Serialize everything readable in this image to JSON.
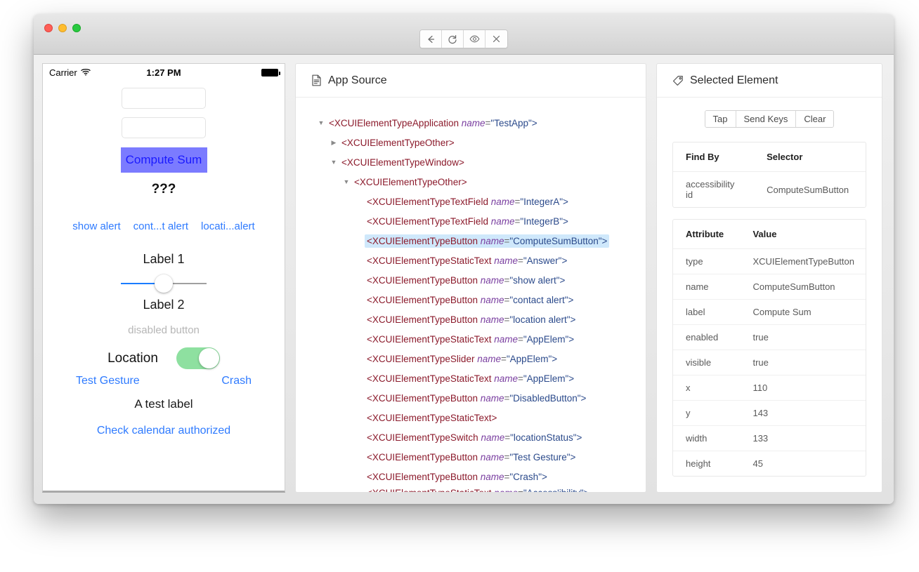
{
  "window": {
    "traffic_lights": [
      "close",
      "minimize",
      "maximize"
    ],
    "toolbar": [
      {
        "name": "back-button",
        "icon": "arrow-left-icon"
      },
      {
        "name": "refresh-button",
        "icon": "refresh-icon"
      },
      {
        "name": "inspect-button",
        "icon": "eye-icon"
      },
      {
        "name": "quit-button",
        "icon": "close-icon"
      }
    ]
  },
  "phone": {
    "status_bar": {
      "carrier": "Carrier",
      "wifi": "wifi-icon",
      "time": "1:27 PM",
      "battery": "battery-icon"
    },
    "fields": [
      {
        "value": "",
        "placeholder": ""
      },
      {
        "value": "",
        "placeholder": ""
      }
    ],
    "compute_button": "Compute Sum",
    "answer": "???",
    "alerts": [
      "show alert",
      "cont...t alert",
      "locati...alert"
    ],
    "label1": "Label 1",
    "slider_value": 50,
    "label2": "Label 2",
    "disabled_button": "disabled button",
    "location_label": "Location",
    "location_switch": "on",
    "test_gesture": "Test Gesture",
    "crash": "Crash",
    "test_label": "A test label",
    "calendar_link": "Check calendar authorized"
  },
  "source": {
    "title": "App Source",
    "icon": "file-document-icon",
    "nodes": [
      {
        "depth": 0,
        "twist": "expanded",
        "tag": "XCUIElementTypeApplication",
        "attr": "name",
        "value": "TestApp",
        "selected": false
      },
      {
        "depth": 1,
        "twist": "collapsed",
        "tag": "XCUIElementTypeOther",
        "attr": "",
        "value": "",
        "selected": false
      },
      {
        "depth": 1,
        "twist": "expanded",
        "tag": "XCUIElementTypeWindow",
        "attr": "",
        "value": "",
        "selected": false
      },
      {
        "depth": 2,
        "twist": "expanded",
        "tag": "XCUIElementTypeOther",
        "attr": "",
        "value": "",
        "selected": false
      },
      {
        "depth": 3,
        "twist": "none",
        "tag": "XCUIElementTypeTextField",
        "attr": "name",
        "value": "IntegerA",
        "selected": false
      },
      {
        "depth": 3,
        "twist": "none",
        "tag": "XCUIElementTypeTextField",
        "attr": "name",
        "value": "IntegerB",
        "selected": false
      },
      {
        "depth": 3,
        "twist": "none",
        "tag": "XCUIElementTypeButton",
        "attr": "name",
        "value": "ComputeSumButton",
        "selected": true
      },
      {
        "depth": 3,
        "twist": "none",
        "tag": "XCUIElementTypeStaticText",
        "attr": "name",
        "value": "Answer",
        "selected": false
      },
      {
        "depth": 3,
        "twist": "none",
        "tag": "XCUIElementTypeButton",
        "attr": "name",
        "value": "show alert",
        "selected": false
      },
      {
        "depth": 3,
        "twist": "none",
        "tag": "XCUIElementTypeButton",
        "attr": "name",
        "value": "contact alert",
        "selected": false
      },
      {
        "depth": 3,
        "twist": "none",
        "tag": "XCUIElementTypeButton",
        "attr": "name",
        "value": "location alert",
        "selected": false
      },
      {
        "depth": 3,
        "twist": "none",
        "tag": "XCUIElementTypeStaticText",
        "attr": "name",
        "value": "AppElem",
        "selected": false
      },
      {
        "depth": 3,
        "twist": "none",
        "tag": "XCUIElementTypeSlider",
        "attr": "name",
        "value": "AppElem",
        "selected": false
      },
      {
        "depth": 3,
        "twist": "none",
        "tag": "XCUIElementTypeStaticText",
        "attr": "name",
        "value": "AppElem",
        "selected": false
      },
      {
        "depth": 3,
        "twist": "none",
        "tag": "XCUIElementTypeButton",
        "attr": "name",
        "value": "DisabledButton",
        "selected": false
      },
      {
        "depth": 3,
        "twist": "none",
        "tag": "XCUIElementTypeStaticText",
        "attr": "",
        "value": "",
        "selected": false
      },
      {
        "depth": 3,
        "twist": "none",
        "tag": "XCUIElementTypeSwitch",
        "attr": "name",
        "value": "locationStatus",
        "selected": false
      },
      {
        "depth": 3,
        "twist": "none",
        "tag": "XCUIElementTypeButton",
        "attr": "name",
        "value": "Test Gesture",
        "selected": false
      },
      {
        "depth": 3,
        "twist": "none",
        "tag": "XCUIElementTypeButton",
        "attr": "name",
        "value": "Crash",
        "selected": false
      },
      {
        "depth": 3,
        "twist": "none",
        "tag": "XCUIElementTypeStaticText",
        "attr": "name",
        "value": "Access'ibility",
        "selected": false,
        "clipped": true
      }
    ]
  },
  "selected": {
    "title": "Selected Element",
    "icon": "tag-icon",
    "actions": [
      "Tap",
      "Send Keys",
      "Clear"
    ],
    "find_by": {
      "headers": [
        "Find By",
        "Selector"
      ],
      "rows": [
        [
          "accessibility id",
          "ComputeSumButton"
        ]
      ]
    },
    "attributes": {
      "headers": [
        "Attribute",
        "Value"
      ],
      "rows": [
        [
          "type",
          "XCUIElementTypeButton"
        ],
        [
          "name",
          "ComputeSumButton"
        ],
        [
          "label",
          "Compute Sum"
        ],
        [
          "enabled",
          "true"
        ],
        [
          "visible",
          "true"
        ],
        [
          "x",
          "110"
        ],
        [
          "y",
          "143"
        ],
        [
          "width",
          "133"
        ],
        [
          "height",
          "45"
        ]
      ]
    }
  },
  "colors": {
    "highlight": "#7b7bff",
    "tree_selection": "#cfe8fb",
    "ios_link": "#2f7bff",
    "switch_on": "#8ee0a0"
  }
}
